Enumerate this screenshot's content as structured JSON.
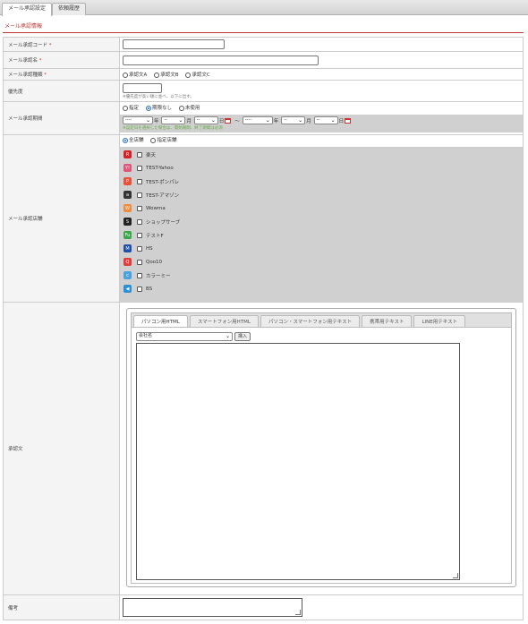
{
  "tabs": [
    {
      "label": "メール承認設定",
      "active": true
    },
    {
      "label": "依頼履歴",
      "active": false
    }
  ],
  "section_title": "メール承認情報",
  "fields": {
    "code": {
      "label": "メール承認コード",
      "required_mark": "*",
      "value": ""
    },
    "name": {
      "label": "メール承認名",
      "required_mark": "*",
      "value": ""
    },
    "type": {
      "label": "メール承認種類",
      "required_mark": "*",
      "options": [
        "承認文A",
        "承認文B",
        "承認文C"
      ]
    },
    "priority": {
      "label": "優先度",
      "value": "",
      "hint": "※優先度が高い順に並べ、以下に出す。"
    },
    "period": {
      "label": "メール承認期間",
      "options": [
        "指定",
        "期限なし",
        "未使用"
      ],
      "selected": 1,
      "date_placeholder": "----",
      "part_placeholder": "--",
      "units": [
        "年",
        "月",
        "日",
        "年",
        "月",
        "日"
      ],
      "separator": "〜",
      "hint": "※設定日を選択した場合は、開始期間、終了期間は必須"
    },
    "shops": {
      "label": "メール承認店舗",
      "mode_options": [
        "全店舗",
        "指定店舗"
      ],
      "mode_selected": 0,
      "items": [
        {
          "name": "楽天",
          "icon": "rakuten-icon",
          "color": "#d61f26",
          "glyph": "R"
        },
        {
          "name": "TEST-Yahoo",
          "icon": "yahoo-icon",
          "color": "#e0557a",
          "glyph": "Y!"
        },
        {
          "name": "TEST-ポンパレ",
          "icon": "ponpare-icon",
          "color": "#e8513a",
          "glyph": "P"
        },
        {
          "name": "TEST-アマゾン",
          "icon": "amazon-icon",
          "color": "#333333",
          "glyph": "a"
        },
        {
          "name": "Wowma",
          "icon": "wowma-icon",
          "color": "#f08a3c",
          "glyph": "W"
        },
        {
          "name": "ショップサーブ",
          "icon": "shopserve-icon",
          "color": "#222222",
          "glyph": "S"
        },
        {
          "name": "テストF",
          "icon": "future-shop-icon",
          "color": "#3aa84a",
          "glyph": "Fu"
        },
        {
          "name": "HS",
          "icon": "hs-icon",
          "color": "#1f4fa8",
          "glyph": "M"
        },
        {
          "name": "Qoo10",
          "icon": "qoo10-icon",
          "color": "#e33b3b",
          "glyph": "Q"
        },
        {
          "name": "カラーミー",
          "icon": "colorme-icon",
          "color": "#4aa3df",
          "glyph": "c"
        },
        {
          "name": "BS",
          "icon": "bs-icon",
          "color": "#2b8fd6",
          "glyph": "◀"
        }
      ]
    },
    "body": {
      "label": "承認文",
      "tabs": [
        "パソコン用HTML",
        "スマートフォン用HTML",
        "パソコン・スマートフォン用テキスト",
        "携帯用テキスト",
        "LINE用テキスト"
      ],
      "active_tab": 0,
      "insert_select": "会社名",
      "insert_button": "挿入",
      "value": ""
    },
    "note": {
      "label": "備考",
      "value": ""
    }
  },
  "colors": {
    "accent": "#bb3333",
    "radio_selected": "#2a6fd6",
    "gray_band": "#d0d0d0"
  }
}
